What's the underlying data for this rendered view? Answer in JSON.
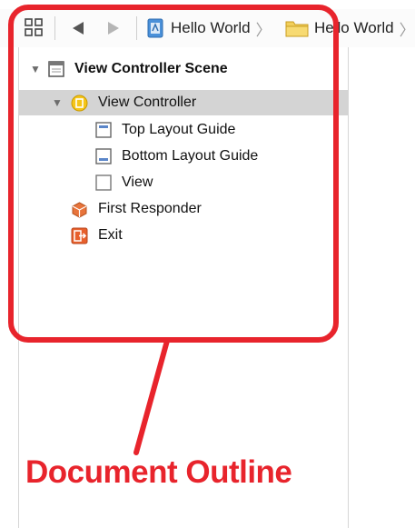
{
  "toolbar": {
    "grid_icon": "related-items-grid-icon",
    "back_icon": "back-arrow-icon",
    "forward_icon": "forward-arrow-icon",
    "breadcrumbs": [
      {
        "label": "Hello World",
        "icon": "project-file-icon"
      },
      {
        "label": "Hello World",
        "icon": "folder-icon"
      }
    ]
  },
  "outline": {
    "scene": {
      "label": "View Controller Scene",
      "icon": "scene-icon"
    },
    "controller": {
      "label": "View Controller",
      "icon": "view-controller-icon"
    },
    "children": [
      {
        "label": "Top Layout Guide",
        "icon": "top-layout-guide-icon"
      },
      {
        "label": "Bottom Layout Guide",
        "icon": "bottom-layout-guide-icon"
      },
      {
        "label": "View",
        "icon": "view-icon"
      }
    ],
    "first_responder": {
      "label": "First Responder",
      "icon": "first-responder-icon"
    },
    "exit": {
      "label": "Exit",
      "icon": "exit-icon"
    }
  },
  "annotation": {
    "caption": "Document Outline",
    "color": "#e8242c"
  }
}
